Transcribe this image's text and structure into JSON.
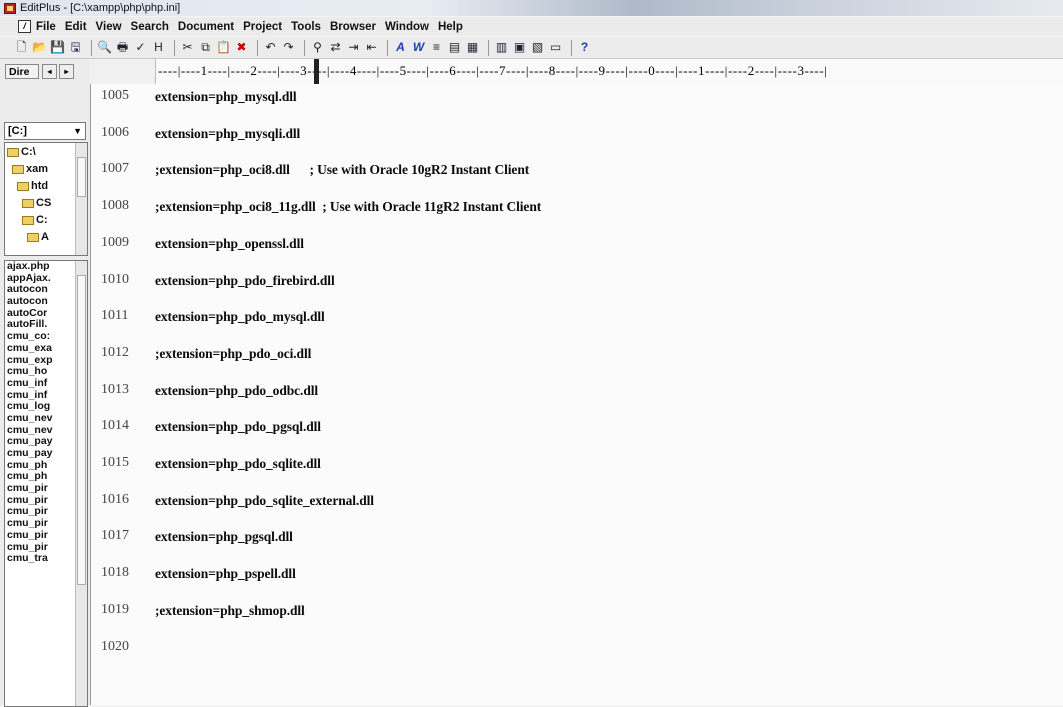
{
  "window": {
    "title": "EditPlus - [C:\\xampp\\php\\php.ini]"
  },
  "menu": [
    "File",
    "Edit",
    "View",
    "Search",
    "Document",
    "Project",
    "Tools",
    "Browser",
    "Window",
    "Help"
  ],
  "toolbar": {
    "icons": [
      "new-file-icon",
      "open-folder-icon",
      "save-icon",
      "save-all-icon",
      "sep",
      "print-preview-icon",
      "print-icon",
      "spellcheck-icon",
      "html-preview-icon",
      "sep",
      "cut-icon",
      "copy-icon",
      "paste-icon",
      "delete-icon",
      "sep",
      "undo-icon",
      "redo-icon",
      "sep",
      "find-icon",
      "replace-icon",
      "goto-icon",
      "indent-icon",
      "sep",
      "font-icon",
      "word-wrap-icon",
      "line-number-icon",
      "ruler-icon",
      "column-select-icon",
      "sep",
      "split-icon",
      "view-icon",
      "tools-icon",
      "window-icon",
      "sep",
      "help-icon"
    ]
  },
  "sidebar": {
    "directory_label": "Dire",
    "drive": "[C:]",
    "tree": [
      {
        "label": "C:\\",
        "indent": 0
      },
      {
        "label": "xam",
        "indent": 1
      },
      {
        "label": "htd",
        "indent": 2
      },
      {
        "label": "CS",
        "indent": 3
      },
      {
        "label": "C:",
        "indent": 3
      },
      {
        "label": "A",
        "indent": 4
      }
    ],
    "files": [
      "ajax.php",
      "appAjax.",
      "autocon",
      "autocon",
      "autoCor",
      "autoFill.",
      "cmu_co:",
      "cmu_exa",
      "cmu_exp",
      "cmu_ho",
      "cmu_inf",
      "cmu_inf",
      "cmu_log",
      "cmu_nev",
      "cmu_nev",
      "cmu_pay",
      "cmu_pay",
      "cmu_ph",
      "cmu_ph",
      "cmu_pir",
      "cmu_pir",
      "cmu_pir",
      "cmu_pir",
      "cmu_pir",
      "cmu_pir",
      "cmu_tra"
    ]
  },
  "ruler": {
    "text": "----|----1----|----2----|----3----|----4----|----5----|----6----|----7----|----8----|----9----|----0----|----1----|----2----|----3----|"
  },
  "editor": {
    "lines": [
      {
        "num": "1005",
        "text": "extension=php_mysql.dll"
      },
      {
        "num": "1006",
        "text": "extension=php_mysqli.dll"
      },
      {
        "num": "1007",
        "text": ";extension=php_oci8.dll      ; Use with Oracle 10gR2 Instant Client"
      },
      {
        "num": "1008",
        "text": ";extension=php_oci8_11g.dll  ; Use with Oracle 11gR2 Instant Client"
      },
      {
        "num": "1009",
        "text": "extension=php_openssl.dll"
      },
      {
        "num": "1010",
        "text": "extension=php_pdo_firebird.dll"
      },
      {
        "num": "1011",
        "text": "extension=php_pdo_mysql.dll"
      },
      {
        "num": "1012",
        "text": ";extension=php_pdo_oci.dll"
      },
      {
        "num": "1013",
        "text": "extension=php_pdo_odbc.dll"
      },
      {
        "num": "1014",
        "text": "extension=php_pdo_pgsql.dll"
      },
      {
        "num": "1015",
        "text": "extension=php_pdo_sqlite.dll"
      },
      {
        "num": "1016",
        "text": "extension=php_pdo_sqlite_external.dll"
      },
      {
        "num": "1017",
        "text": "extension=php_pgsql.dll"
      },
      {
        "num": "1018",
        "text": "extension=php_pspell.dll"
      },
      {
        "num": "1019",
        "text": ";extension=php_shmop.dll"
      },
      {
        "num": "1020",
        "text": ""
      }
    ]
  }
}
